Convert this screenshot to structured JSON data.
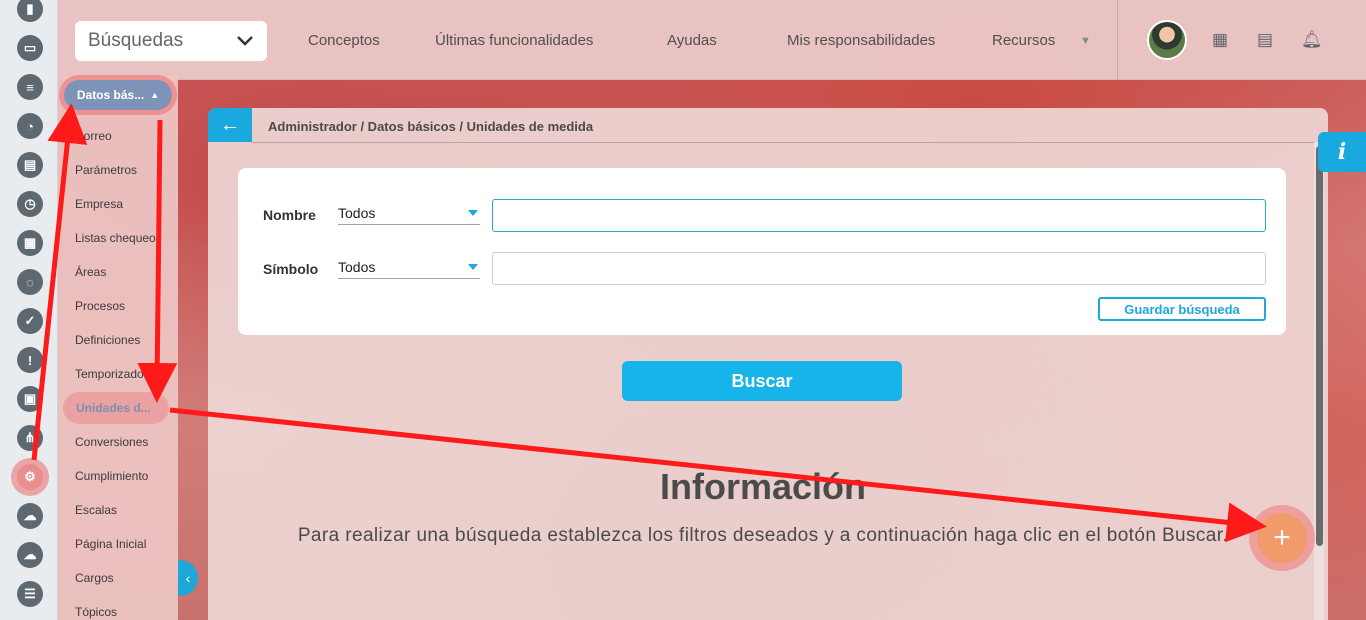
{
  "topbar": {
    "search_select": "Búsquedas",
    "nav": [
      {
        "label": "Conceptos"
      },
      {
        "label": "Últimas funcionalidades"
      },
      {
        "label": "Ayudas"
      },
      {
        "label": "Mis responsabilidades"
      },
      {
        "label": "Recursos"
      }
    ],
    "icons": [
      "calendar-icon",
      "map-icon",
      "bell-icon"
    ]
  },
  "rail": {
    "icons": [
      "chart-icon",
      "monitor-icon",
      "align-icon",
      "pie-icon",
      "map-icon",
      "clock-icon",
      "document-icon",
      "cycle-icon",
      "check-icon",
      "warning-icon",
      "calendar-icon",
      "flow-icon",
      "gear-icon",
      "cloud-settings-icon",
      "cloud-icon",
      "list-icon"
    ],
    "active": "gear-icon"
  },
  "submenu": {
    "header": "Datos bás...",
    "items": [
      {
        "label": "Correo"
      },
      {
        "label": "Parámetros"
      },
      {
        "label": "Empresa"
      },
      {
        "label": "Listas chequeo"
      },
      {
        "label": "Áreas"
      },
      {
        "label": "Procesos"
      },
      {
        "label": "Definiciones"
      },
      {
        "label": "Temporizadores"
      },
      {
        "label": "Unidades d..."
      },
      {
        "label": "Conversiones"
      },
      {
        "label": "Cumplimiento"
      },
      {
        "label": "Escalas"
      },
      {
        "label": "Página Inicial"
      },
      {
        "label": "Cargos"
      },
      {
        "label": "Tópicos"
      }
    ],
    "active_index": 8
  },
  "panel": {
    "breadcrumb": "Administrador / Datos básicos / Unidades de medida",
    "filters": {
      "nombre_label": "Nombre",
      "nombre_operator": "Todos",
      "nombre_value": "",
      "simbolo_label": "Símbolo",
      "simbolo_operator": "Todos",
      "simbolo_value": ""
    },
    "save_search": "Guardar búsqueda",
    "search_button": "Buscar",
    "info_title": "Información",
    "info_text": "Para realizar una búsqueda establezca los filtros deseados y a continuación haga clic en el botón Buscar."
  },
  "info_tab": "i",
  "fab_label": "+",
  "colors": {
    "accent": "#1aa9df",
    "fab": "#f29b6a",
    "annotation": "#ff1a1a"
  }
}
